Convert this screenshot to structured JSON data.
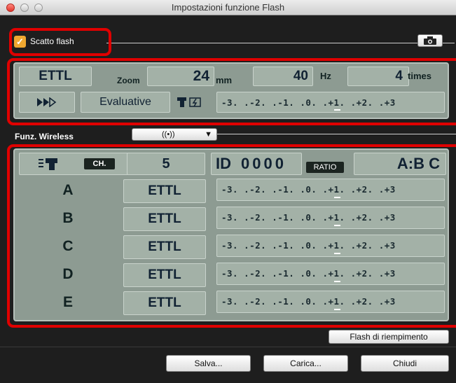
{
  "window": {
    "title": "Impostazioni funzione Flash"
  },
  "flash_toggle": {
    "label": "Scatto flash",
    "checked": true
  },
  "settings": {
    "mode": "ETTL",
    "zoom_label": "Zoom",
    "zoom_value": "24",
    "zoom_unit": "mm",
    "frequency_value": "40",
    "frequency_unit": "Hz",
    "count_value": "4",
    "count_unit": "times",
    "metering": "Evaluative",
    "scale": "-3. .-2. .-1. .0. .+1. .+2. .+3"
  },
  "wireless": {
    "label": "Funz. Wireless",
    "channel_label": "CH.",
    "channel_value": "5",
    "id_label": "ID",
    "id_value": "0000",
    "ratio_label": "RATIO",
    "ratio_value": "A:B C",
    "groups": [
      {
        "name": "A",
        "mode": "ETTL"
      },
      {
        "name": "B",
        "mode": "ETTL"
      },
      {
        "name": "C",
        "mode": "ETTL"
      },
      {
        "name": "D",
        "mode": "ETTL"
      },
      {
        "name": "E",
        "mode": "ETTL"
      }
    ]
  },
  "buttons": {
    "fill_flash": "Flash di riempimento",
    "save": "Salva...",
    "load": "Carica...",
    "close": "Chiudi"
  },
  "colors": {
    "highlight": "#e00000",
    "lcd_panel": "#8d9b92",
    "lcd_cell": "#a3b1a7",
    "check": "#f0a830"
  }
}
